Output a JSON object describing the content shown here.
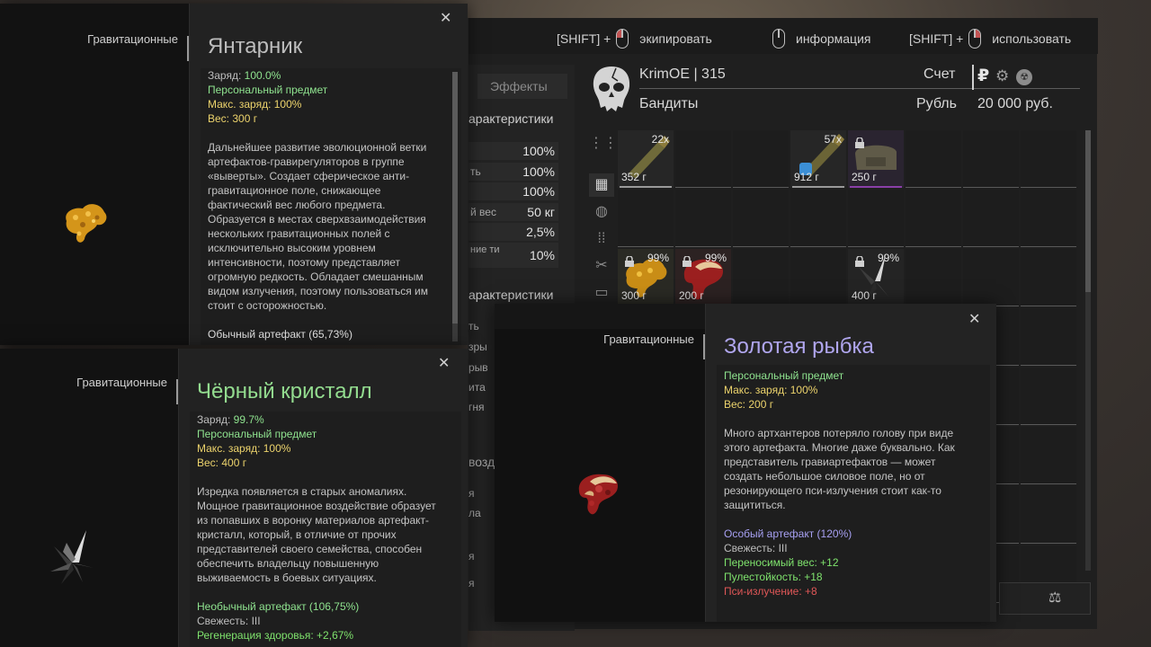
{
  "hints": [
    {
      "shift": "[SHIFT] +",
      "label": "экипировать",
      "button": "l"
    },
    {
      "shift": "",
      "label": "информация",
      "button": "n"
    },
    {
      "shift": "[SHIFT] +",
      "label": "использовать",
      "button": "r"
    }
  ],
  "left_panel": {
    "tab_effects": "Эффекты",
    "char_head_1": "арактеристики",
    "stats": [
      {
        "label": "",
        "value": "100%"
      },
      {
        "label": "ть",
        "value": "100%"
      },
      {
        "label": "",
        "value": "100%"
      },
      {
        "label": "й вес",
        "value": "50 кг"
      },
      {
        "label": "",
        "value": "2,5%"
      },
      {
        "label": "ние ти",
        "value": "10%"
      }
    ],
    "char_head_2": "арактеристики",
    "fragments": [
      "ть",
      "зры",
      "рыв",
      "ита",
      "гня",
      "возде",
      "я",
      "ла",
      "я",
      "я"
    ]
  },
  "player": {
    "name": "KrimOE | 315",
    "faction": "Бандиты",
    "account_label": "Счет",
    "currency_label": "Рубль",
    "ruble_sign": "₽",
    "money": "20 000 руб."
  },
  "grid_items": [
    {
      "qty": "22x",
      "weight": "352 г",
      "kind": "ammo"
    },
    {
      "qty": "57x",
      "weight": "912 г",
      "kind": "ammo2"
    },
    {
      "qty": "",
      "weight": "250 г",
      "kind": "bag",
      "locked": true
    },
    {
      "qty": "99%",
      "weight": "300 г",
      "kind": "amber",
      "locked": true
    },
    {
      "qty": "99%",
      "weight": "200 г",
      "kind": "fish",
      "locked": true
    },
    {
      "qty": "99%",
      "weight": "400 г",
      "kind": "crystal",
      "locked": true
    }
  ],
  "popup_amber": {
    "category": "Гравитационные",
    "title": "Янтарник",
    "charge_label": "Заряд:",
    "charge_value": "100.0%",
    "personal": "Персональный предмет",
    "max_charge": "Макс. заряд: 100%",
    "weight": "Вес: 300 г",
    "description": "Дальнейшее развитие эволюционной ветки артефактов-гравирегуляторов в группе «выверты». Создает сферическое анти-гравитационное поле, снижающее фактический вес любого предмета. Образуется в местах сверхвзаимодействия нескольких гравитационных полей с исключительно высоким уровнем интенсивности, поэтому представляет огромную редкость. Обладает смешанным видом излучения, поэтому пользоваться им стоит с осторожностью.",
    "rarity": "Обычный артефакт (65,73%)"
  },
  "popup_crystal": {
    "category": "Гравитационные",
    "title": "Чёрный кристалл",
    "charge_label": "Заряд:",
    "charge_value": "99.7%",
    "personal": "Персональный предмет",
    "max_charge": "Макс. заряд: 100%",
    "weight": "Вес: 400 г",
    "description": "Изредка появляется в старых аномалиях. Мощное гравитационное воздействие образует из попавших в воронку материалов артефакт-кристалл, который, в отличие от прочих представителей своего семейства, способен обеспечить владельцу повышенную выживаемость в боевых ситуациях.",
    "rarity": "Необычный артефакт (106,75%)",
    "freshness": "Свежесть: III",
    "stat1": "Регенерация здоровья: +2,67%"
  },
  "popup_fish": {
    "category": "Гравитационные",
    "title": "Золотая рыбка",
    "personal": "Персональный предмет",
    "max_charge": "Макс. заряд: 100%",
    "weight": "Вес: 200 г",
    "description": "Много артхантеров потеряло голову при виде этого артефакта. Многие даже буквально. Как представитель гравиартефактов — может создать небольшое силовое поле, но от резонирующего пси-излучения стоит как-то защититься.",
    "rarity": "Особый артефакт (120%)",
    "freshness": "Свежесть: III",
    "stat1": "Переносимый вес: +12",
    "stat2": "Пулестойкость: +18",
    "stat3": "Пси-излучение: +8"
  }
}
